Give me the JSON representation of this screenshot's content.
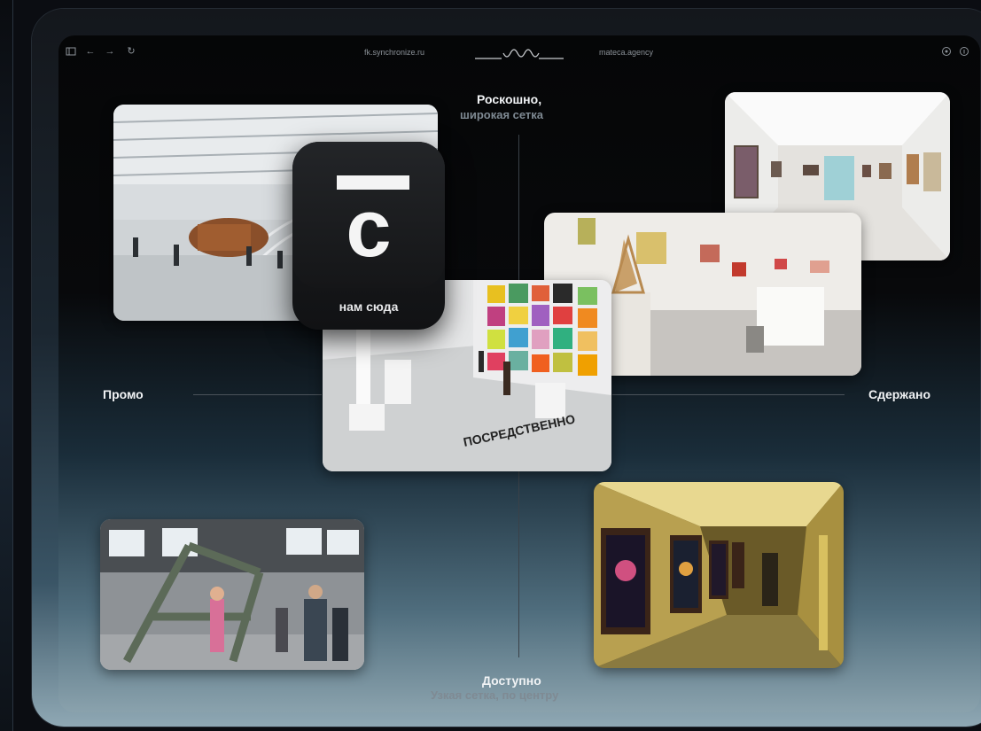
{
  "browser": {
    "url_left": "fk.synchronize.ru",
    "url_right": "mateca.agency",
    "icons": [
      "sidebar-icon",
      "back-icon",
      "forward-icon",
      "reload-icon",
      "extension-icon",
      "info-icon"
    ]
  },
  "labels": {
    "top_title": "Роскошно,",
    "top_sub": "широкая сетка",
    "left": "Промо",
    "right": "Сдержано",
    "bottom_title": "Доступно",
    "bottom_sub": "Узкая сетка, по центру"
  },
  "app_icon": {
    "letter": "с",
    "caption": "нам сюда"
  },
  "photos": [
    {
      "name": "photo-atrium-installation",
      "description": "hall"
    },
    {
      "name": "photo-white-gallery"
    },
    {
      "name": "photo-art-exhibition"
    },
    {
      "name": "photo-colorful-installation",
      "caption": "ПОСРЕДСТВЕННО"
    },
    {
      "name": "photo-industrial-hall"
    },
    {
      "name": "photo-metro-gallery"
    }
  ],
  "photo_texts": {
    "floor_text": "ПОСРЕДСТВЕННО"
  },
  "colors": {
    "background": "#0b0d12",
    "label_primary": "#f1f3f5",
    "label_secondary": "#7f8a93"
  }
}
